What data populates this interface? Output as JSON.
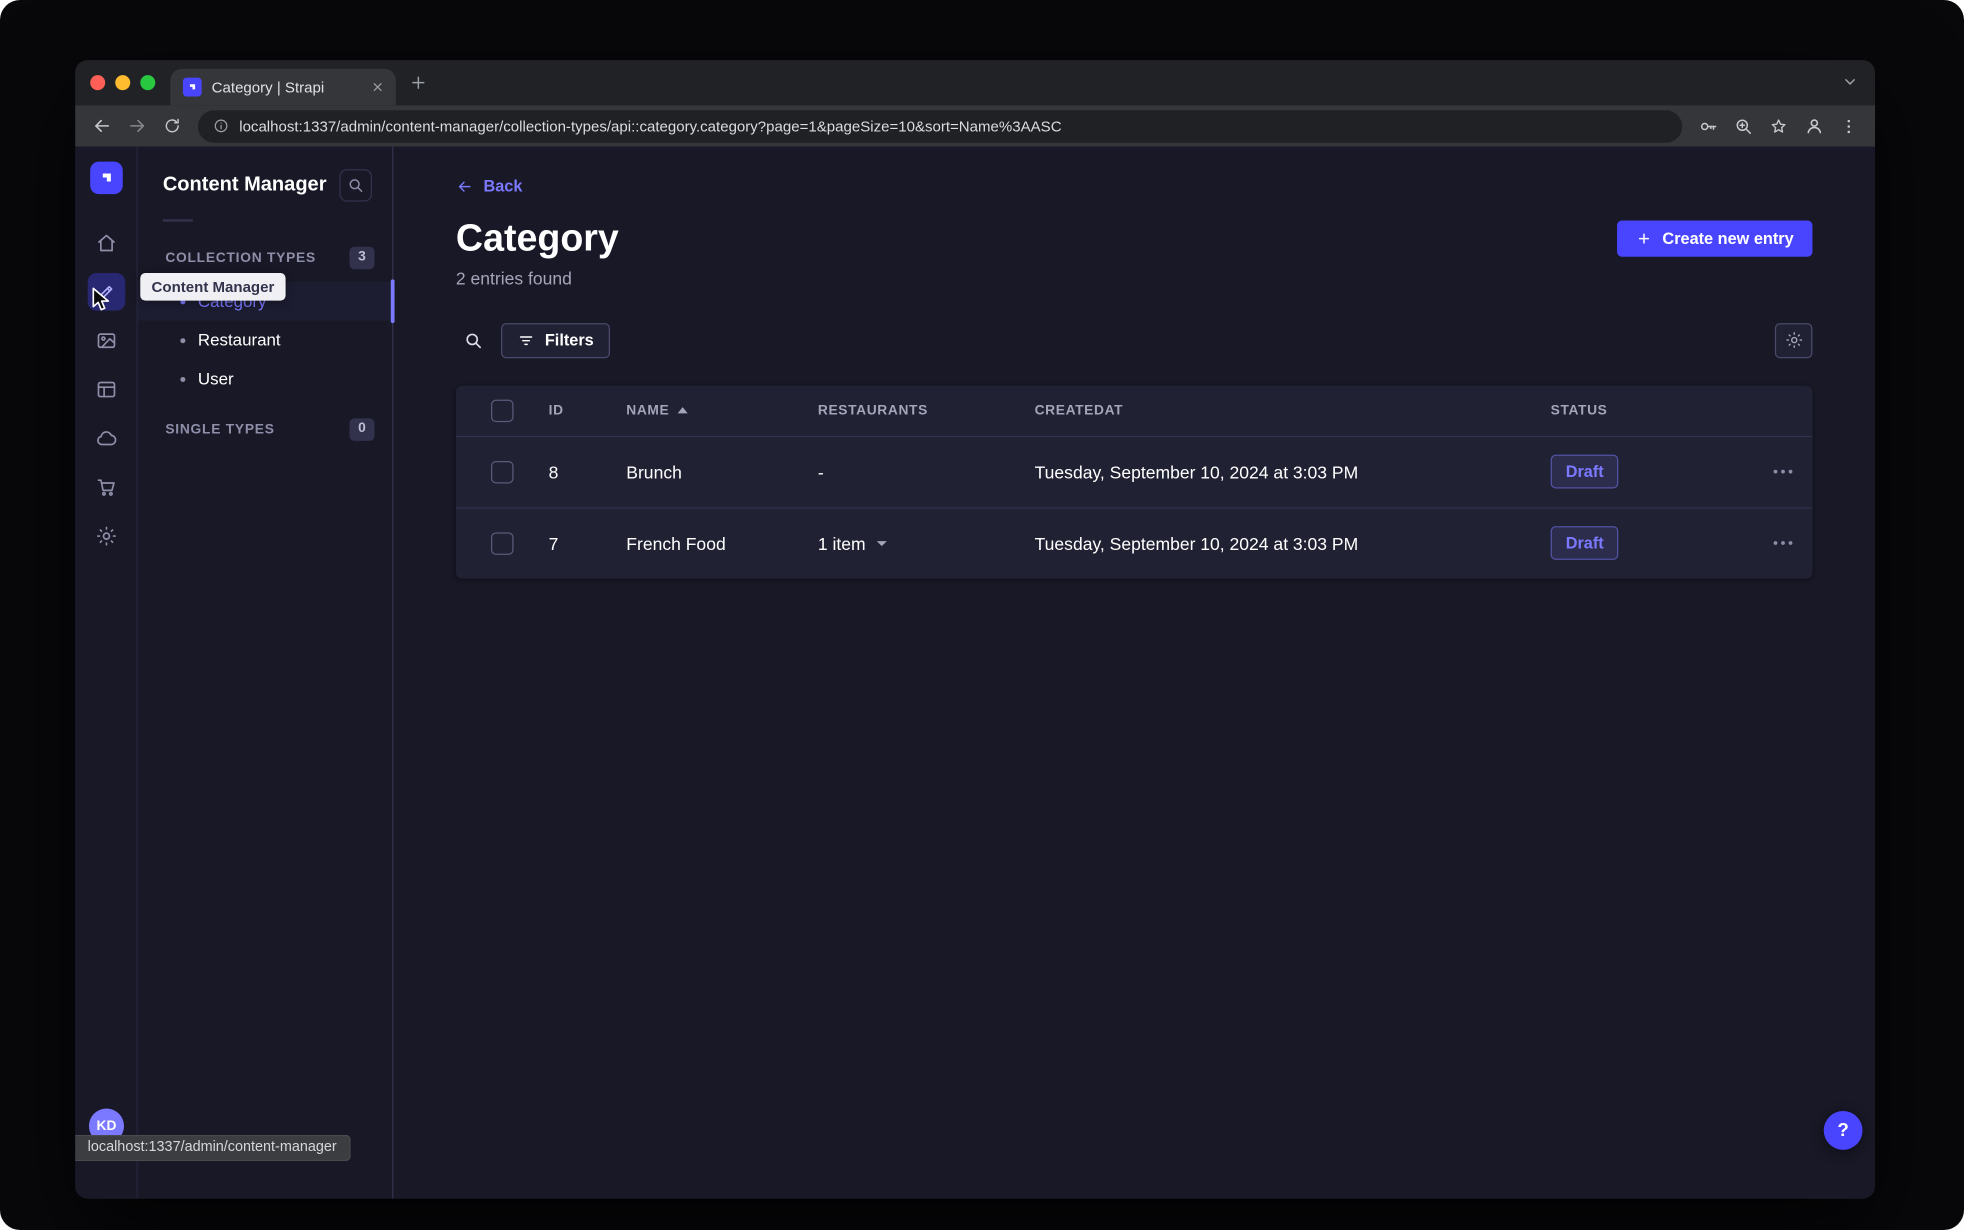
{
  "colors": {
    "primary": "#4945ff",
    "link": "#7b79ff",
    "page_bg": "#181826",
    "card_bg": "#212134",
    "border": "#32324d"
  },
  "window": {
    "tab": {
      "title": "Category | Strapi"
    },
    "url": "localhost:1337/admin/content-manager/collection-types/api::category.category?page=1&pageSize=10&sort=Name%3AASC",
    "status_link": "localhost:1337/admin/content-manager"
  },
  "rail": {
    "icons": [
      "home",
      "content-manager",
      "media-library",
      "content-type-builder",
      "cloud",
      "marketplace",
      "settings"
    ],
    "avatar": "KD"
  },
  "tooltip": {
    "text": "Content Manager"
  },
  "subnav": {
    "title": "Content Manager",
    "sections": [
      {
        "label": "COLLECTION TYPES",
        "badge": "3",
        "items": [
          {
            "label": "Category",
            "active": true
          },
          {
            "label": "Restaurant",
            "active": false
          },
          {
            "label": "User",
            "active": false
          }
        ]
      },
      {
        "label": "SINGLE TYPES",
        "badge": "0",
        "items": []
      }
    ]
  },
  "main": {
    "back_label": "Back",
    "title": "Category",
    "subtitle": "2 entries found",
    "create_button": "Create new entry",
    "filters_button": "Filters",
    "table": {
      "headers": {
        "id": "ID",
        "name": "NAME",
        "restaurants": "RESTAURANTS",
        "createdat": "CREATEDAT",
        "status": "STATUS"
      },
      "rows": [
        {
          "id": "8",
          "name": "Brunch",
          "restaurants": "-",
          "createdat": "Tuesday, September 10, 2024 at 3:03 PM",
          "status": "Draft"
        },
        {
          "id": "7",
          "name": "French Food",
          "restaurants": "1 item",
          "createdat": "Tuesday, September 10, 2024 at 3:03 PM",
          "status": "Draft"
        }
      ]
    }
  },
  "help": {
    "label": "?"
  }
}
